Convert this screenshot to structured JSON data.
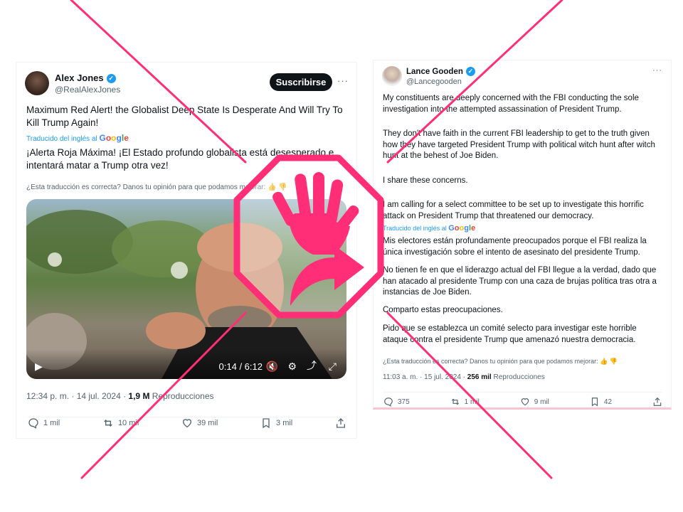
{
  "left_tweet": {
    "name": "Alex Jones",
    "handle": "@RealAlexJones",
    "subscribe_label": "Suscribirse",
    "more": "···",
    "text_en": "Maximum Red Alert! the Globalist Deep State Is Desperate And Will Try To Kill Trump Again!",
    "translated_by": "Traducido del inglés al",
    "google": [
      "G",
      "o",
      "o",
      "g",
      "l",
      "e"
    ],
    "text_es": "¡Alerta Roja Máxima! ¡El Estado profundo globalista está desesperado e intentará matar a Trump otra vez!",
    "translation_question": "¿Esta traducción es correcta? Danos tu opinión para que podamos mejorar:",
    "video": {
      "time": "0:14 / 6:12"
    },
    "timestamp": "12:34 p. m. · 14 jul. 2024 · ",
    "views": "1,9 M",
    "views_label": " Reproducciones",
    "actions": {
      "replies": "1 mil",
      "reposts": "10 mil",
      "likes": "39 mil",
      "bookmarks": "3 mil"
    }
  },
  "right_tweet": {
    "name": "Lance Gooden",
    "handle": "@Lancegooden",
    "more": "···",
    "p1": "My constituents are deeply concerned with the FBI conducting the sole investigation into the attempted assassination of President Trump.",
    "p2": "They don't have faith in the current FBI leadership to get to the truth given how they have targeted President Trump with political witch hunt after witch hunt at the behest of Joe Biden.",
    "p3": "I share these concerns.",
    "p4": "I am calling for a select committee to be set up to investigate this horrific attack on President Trump that threatened our democracy.",
    "translated_by": "Traducido del inglés al",
    "google": [
      "G",
      "o",
      "o",
      "g",
      "l",
      "e"
    ],
    "e1": "Mis electores están profundamente preocupados porque el FBI realiza la única investigación sobre el intento de asesinato del presidente Trump.",
    "e2": "No tienen fe en que el liderazgo actual del FBI llegue a la verdad, dado que han atacado al presidente Trump con una caza de brujas política tras otra a instancias de Joe Biden.",
    "e3": "Comparto estas preocupaciones.",
    "e4": "Pido que se establezca un comité selecto para investigar este horrible ataque contra el presidente Trump que amenazó nuestra democracia.",
    "translation_question": "¿Esta traducción es correcta? Danos tu opinión para que podamos mejorar:",
    "timestamp": "11:03 a. m. · 15 jul. 2024 · ",
    "views": "256 mil",
    "views_label": " Reproducciones",
    "actions": {
      "replies": "375",
      "reposts": "1 mil",
      "likes": "9 mil",
      "bookmarks": "42"
    }
  },
  "colors": {
    "overlay": "#ff2e77",
    "link": "#1d9bf0",
    "text": "#0f1419",
    "muted": "#536471"
  }
}
